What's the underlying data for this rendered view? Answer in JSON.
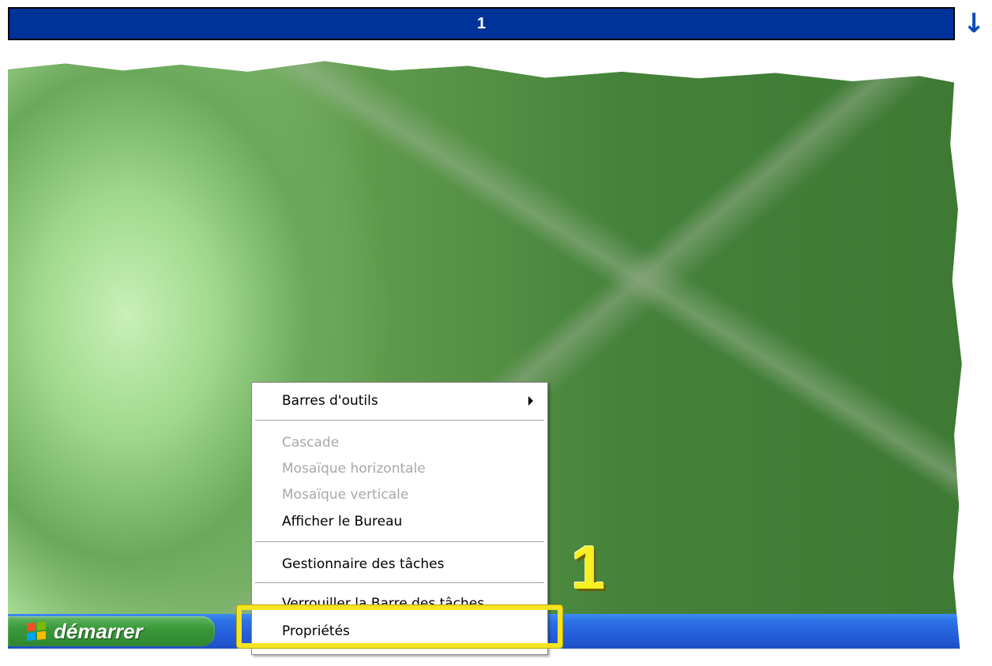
{
  "header": {
    "step_label": "1",
    "scroll_icon": "arrow-down-icon",
    "bar_color": "#003399"
  },
  "taskbar": {
    "start_label": "démarrer",
    "start_icon": "windows-logo-icon",
    "color": "#245edb"
  },
  "context_menu": {
    "toolbars": "Barres d'outils",
    "cascade": "Cascade",
    "tile_horizontal": "Mosaïque horizontale",
    "tile_vertical": "Mosaïque verticale",
    "show_desktop": "Afficher le Bureau",
    "task_manager": "Gestionnaire des tâches",
    "lock_taskbar": "Verrouiller la Barre des tâches",
    "properties": "Propriétés"
  },
  "annotation": {
    "step_number": "1",
    "highlight_color": "#f5e422"
  }
}
